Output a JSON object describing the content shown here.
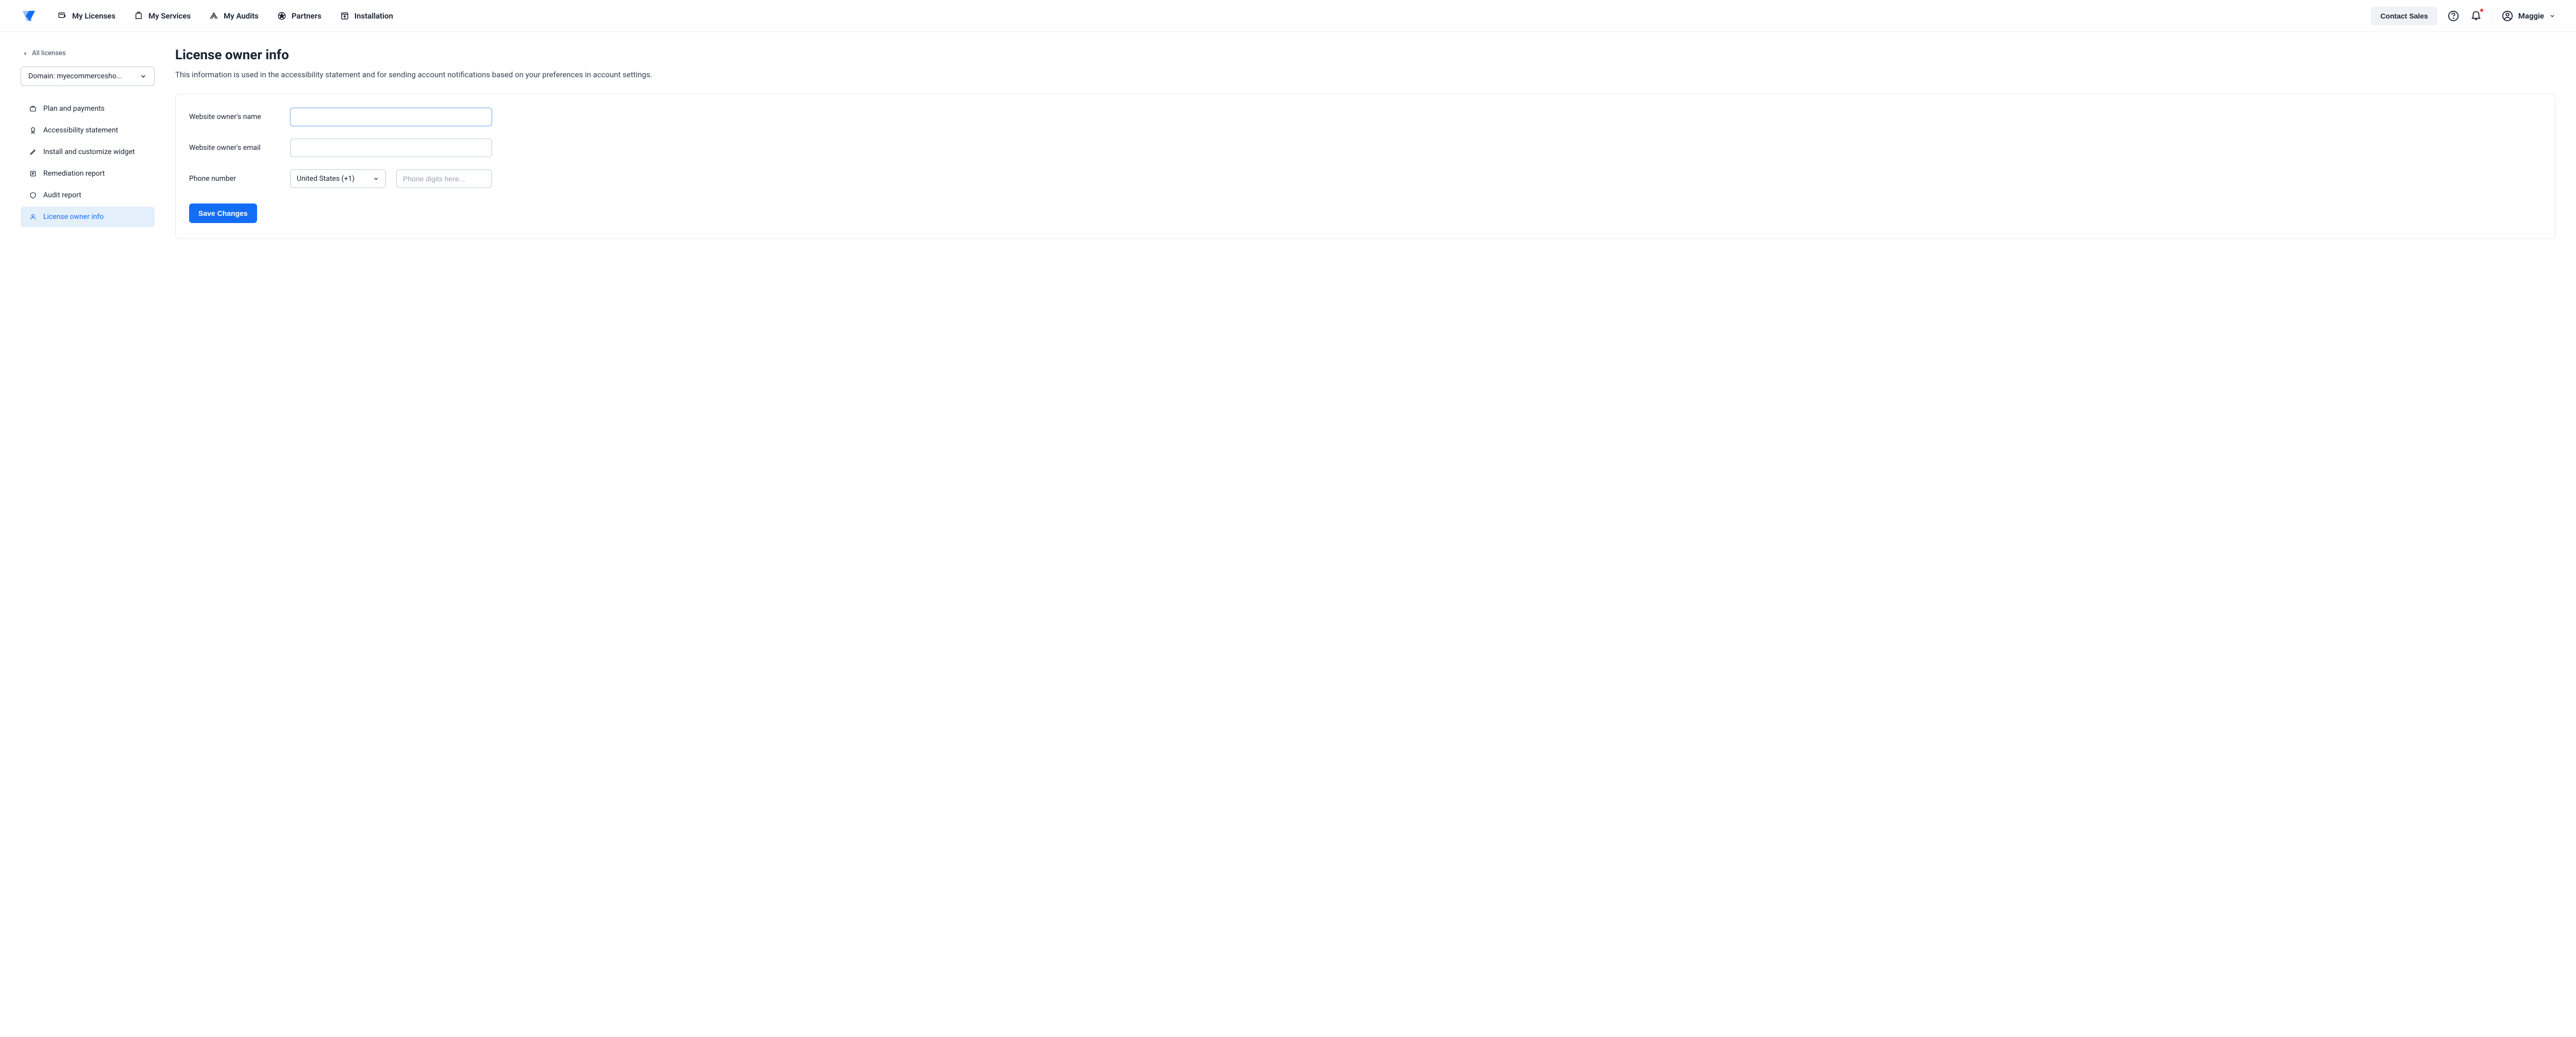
{
  "header": {
    "nav": [
      {
        "label": "My Licenses",
        "icon": "licenses"
      },
      {
        "label": "My Services",
        "icon": "services"
      },
      {
        "label": "My Audits",
        "icon": "audits"
      },
      {
        "label": "Partners",
        "icon": "partners"
      },
      {
        "label": "Installation",
        "icon": "installation"
      }
    ],
    "contact_sales": "Contact Sales",
    "user_name": "Maggie"
  },
  "sidebar": {
    "back_link": "All licenses",
    "domain_label": "Domain: myecommercesho...",
    "items": [
      {
        "label": "Plan and payments"
      },
      {
        "label": "Accessibility statement"
      },
      {
        "label": "Install and customize widget"
      },
      {
        "label": "Remediation report"
      },
      {
        "label": "Audit report"
      },
      {
        "label": "License owner info"
      }
    ]
  },
  "content": {
    "title": "License owner info",
    "description": "This information is used in the accessibility statement and for sending account notifications based on your preferences in account settings.",
    "form": {
      "name_label": "Website owner's name",
      "name_value": "",
      "email_label": "Website owner's email",
      "email_value": "",
      "phone_label": "Phone number",
      "country_value": "United States (+1)",
      "phone_placeholder": "Phone digits here...",
      "phone_value": "",
      "save_button": "Save Changes"
    }
  }
}
